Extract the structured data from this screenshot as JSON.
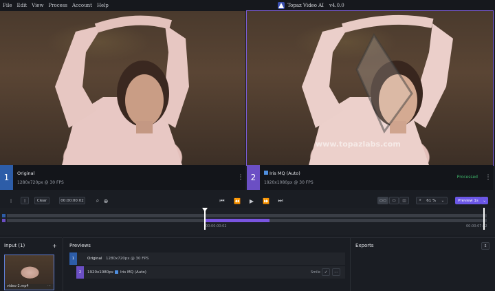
{
  "menu": [
    "File",
    "Edit",
    "View",
    "Process",
    "Account",
    "Help"
  ],
  "app": {
    "title": "Topaz Video AI",
    "version": "v4.0.0"
  },
  "left_view": {
    "index": "1",
    "name": "Original",
    "spec": "1280x720px @ 30 FPS"
  },
  "right_view": {
    "index": "2",
    "model": "Iris MQ (Auto)",
    "spec": "1920x1080px @ 30 FPS",
    "status": "Processed"
  },
  "watermark": "www.topazlabs.com",
  "toolbar": {
    "clear": "Clear",
    "timecode": "00:00:00:02",
    "zoom": "61 %",
    "preview_button": "Preview 1s"
  },
  "timeline": {
    "start_tc": "00:00:00:02",
    "end_tc": "00:00:07:12"
  },
  "input": {
    "title": "Input (1)",
    "add": "+",
    "file": "video-2.mp4"
  },
  "previews": {
    "title": "Previews",
    "rows": [
      {
        "index": "1",
        "label": "Original",
        "spec": "1280x720px @ 30 FPS"
      },
      {
        "index": "2",
        "resolution": "1920x1080px",
        "model": "Iris MQ (Auto)",
        "tag": "Smile"
      }
    ]
  },
  "exports": {
    "title": "Exports"
  },
  "colors": {
    "accent": "#7a55e0",
    "blue": "#2d5da8",
    "purple": "#6b4fc4",
    "processed": "#3fb56a"
  }
}
